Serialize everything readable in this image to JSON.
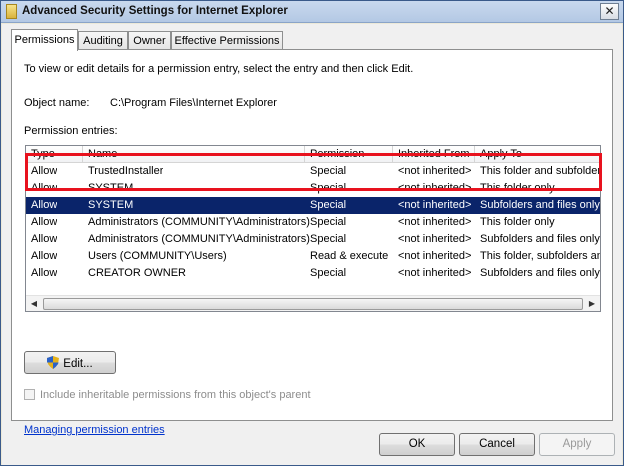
{
  "window": {
    "title": "Advanced Security Settings for Internet Explorer",
    "close_glyph": "✕"
  },
  "tabs": [
    {
      "label": "Permissions",
      "active": true
    },
    {
      "label": "Auditing",
      "active": false
    },
    {
      "label": "Owner",
      "active": false
    },
    {
      "label": "Effective Permissions",
      "active": false
    }
  ],
  "panel": {
    "instruction": "To view or edit details for a permission entry, select the entry and then click Edit.",
    "object_name_label": "Object name:",
    "object_name_value": "C:\\Program Files\\Internet Explorer",
    "entries_label": "Permission entries:"
  },
  "table": {
    "columns": [
      "Type",
      "Name",
      "Permission",
      "Inherited From",
      "Apply To"
    ],
    "rows": [
      {
        "type": "Allow",
        "name": "TrustedInstaller",
        "permission": "Special",
        "inherited": "<not inherited>",
        "apply": "This folder and subfolders"
      },
      {
        "type": "Allow",
        "name": "SYSTEM",
        "permission": "Special",
        "inherited": "<not inherited>",
        "apply": "This folder only"
      },
      {
        "type": "Allow",
        "name": "SYSTEM",
        "permission": "Special",
        "inherited": "<not inherited>",
        "apply": "Subfolders and files only"
      },
      {
        "type": "Allow",
        "name": "Administrators (COMMUNITY\\Administrators)",
        "permission": "Special",
        "inherited": "<not inherited>",
        "apply": "This folder only"
      },
      {
        "type": "Allow",
        "name": "Administrators (COMMUNITY\\Administrators)",
        "permission": "Special",
        "inherited": "<not inherited>",
        "apply": "Subfolders and files only"
      },
      {
        "type": "Allow",
        "name": "Users (COMMUNITY\\Users)",
        "permission": "Read & execute",
        "inherited": "<not inherited>",
        "apply": "This folder, subfolders and"
      },
      {
        "type": "Allow",
        "name": "CREATOR OWNER",
        "permission": "Special",
        "inherited": "<not inherited>",
        "apply": "Subfolders and files only"
      }
    ],
    "selected_row": 2
  },
  "buttons": {
    "edit": "Edit...",
    "ok": "OK",
    "cancel": "Cancel",
    "apply": "Apply"
  },
  "checkbox": {
    "label": "Include inheritable permissions from this object's parent",
    "checked": false,
    "enabled": false
  },
  "link": "Managing permission entries",
  "colors": {
    "selection": "#0a246a",
    "highlight_box": "#e8121e"
  }
}
